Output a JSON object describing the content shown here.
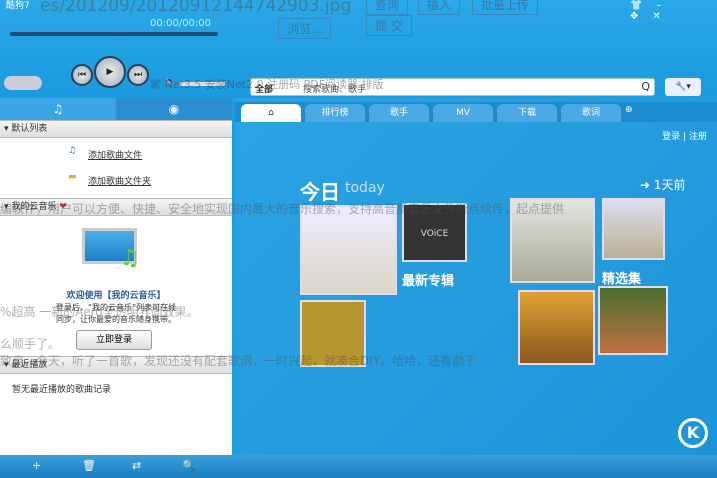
{
  "window": {
    "title": "酷狗7",
    "controls": [
      "skin",
      "minimize",
      "restore",
      "close"
    ]
  },
  "player": {
    "time": "00:00/00:00"
  },
  "search": {
    "category": "全部",
    "placeholder": "搜索歌曲、歌手",
    "button": "Q"
  },
  "tool_button": "🔧▾",
  "left_tabs": [
    "♫",
    "◉"
  ],
  "sections": {
    "default_list": "默认列表",
    "add_file": "添加歌曲文件",
    "add_folder": "添加歌曲文件夹",
    "cloud": "我的云音乐",
    "welcome": "欢迎使用【我的云音乐】",
    "desc1": "登录后，“我的云音乐”列表可在线",
    "desc2": "同步，让你最爱的音乐随身携带。",
    "login": "立即登录",
    "recent": "最近播放",
    "recent_empty": "暂无最近播放的歌曲记录"
  },
  "right_tabs": [
    "⌂",
    "排行榜",
    "歌手",
    "MV",
    "下载",
    "歌词"
  ],
  "account": {
    "login": "登录",
    "sep": "|",
    "register": "注册"
  },
  "content": {
    "today": "今日",
    "today_en": "today",
    "days_ago": "1天前",
    "new_albums": "最新专辑",
    "featured": "精选集",
    "album_text": "VOiCE"
  },
  "bottom": [
    "+",
    "🗑",
    "⇄",
    "🔍"
  ],
  "ghost": {
    "path": "es/201209/20120912144742903.jpg",
    "btn1": "查询",
    "btn2": "插入",
    "btn3": "批量上传",
    "browse": "浏览...",
    "submit": "提 交",
    "line1": "家 Net3.5 安装Net2.0 注册码 PDF阅读器 排版",
    "line2": "编软件，用户可以方便、快捷、安全地实现国内最大的音乐搜索，支持高音质音乐文件断点续传，起点提供",
    "line3": "%超高                                             一新的Aero全透明界面效果。",
    "line4": "么顺手了。",
    "line5": "致高。今天，听了一首歌，发现还没有配套歌词，一时兴起，就凑合DIY。哈哈，还有助于"
  },
  "colors": {
    "accent": "#1b9fe0"
  }
}
